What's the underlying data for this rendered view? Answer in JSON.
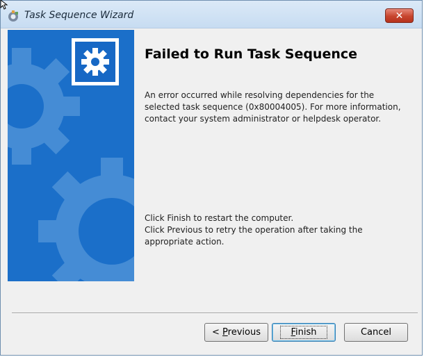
{
  "window": {
    "title": "Task Sequence Wizard",
    "close_label": "✕"
  },
  "main": {
    "heading": "Failed to Run Task Sequence",
    "error_message": "An error occurred while resolving dependencies for the selected task sequence (0x80004005). For more information, contact your system administrator or helpdesk operator.",
    "instruction_1": "Click Finish to restart the computer.",
    "instruction_2": "Click Previous to retry the operation after taking the appropriate action."
  },
  "buttons": {
    "previous_prefix": "< ",
    "previous_mnemonic": "P",
    "previous_rest": "revious",
    "finish_mnemonic": "F",
    "finish_rest": "inish",
    "cancel": "Cancel"
  },
  "colors": {
    "side_panel": "#1b6fc9",
    "gear_shapes": "#4d92d8",
    "close_button": "#c7452e"
  },
  "icons": {
    "title": "task-sequence-icon",
    "logo": "gear-icon",
    "close": "close-icon"
  }
}
